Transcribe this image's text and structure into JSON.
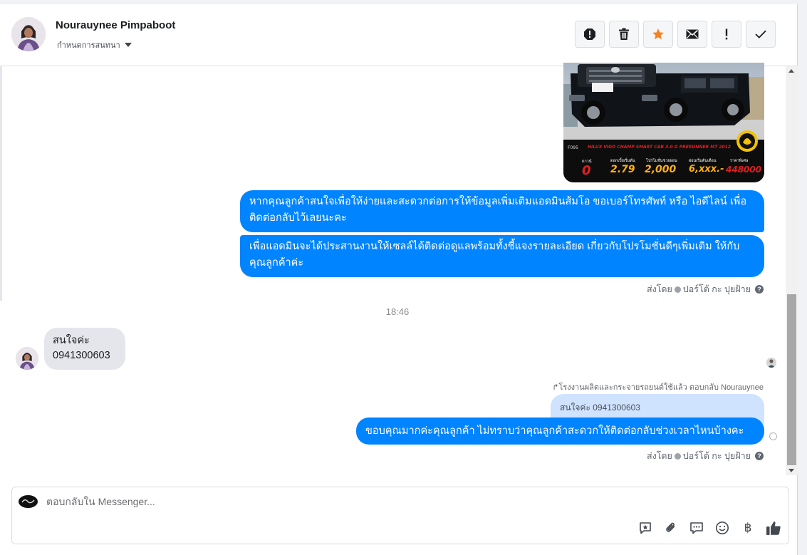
{
  "header": {
    "contact_name": "Nourauynee Pimpaboot",
    "assign_label": "กำหนดการสนทนา",
    "actions": [
      {
        "name": "report-icon",
        "label": "!"
      },
      {
        "name": "trash-icon",
        "label": ""
      },
      {
        "name": "star-icon",
        "label": ""
      },
      {
        "name": "envelope-icon",
        "label": ""
      },
      {
        "name": "exclamation-icon",
        "label": "!"
      },
      {
        "name": "checkmark-icon",
        "label": ""
      }
    ],
    "star_color": "#f5821f"
  },
  "car_ad": {
    "model_text": "HILUX VIGO CHAMP SMART CAB 3.0 G PRERUNNER MT 2012",
    "code": "F095",
    "down_label": "ดาวน์",
    "down_value": "0",
    "interest_label": "ดอกเบี้ยเริ่มต้น",
    "interest_value": "2.79",
    "promo_label": "โปรโมชั่นช่วยผ่อน",
    "promo_value": "2,000",
    "monthly_label": "ผ่อนเริ่มต้นเดือน",
    "monthly_value": "6,xxx.-",
    "price_label": "ราคาพิเศษ",
    "price_value": "448000"
  },
  "messages": {
    "out1": "หากคุณลูกค้าสนใจเพื่อให้ง่ายและสะดวกต่อการให้ข้อมูลเพิ่มเติมแอดมินส้มโอ ขอเบอร์โทรศัพท์ หรือ ไอดีไลน์ เพื่อติดต่อกลับไว้เลยนะคะ",
    "out2": "เพื่อแอดมินจะได้ประสานงานให้เซลล์ได้ติดต่อดูแลพร้อมทั้งชี้แจงรายละเอียด เกี่ยวกับโปรโมชั่นดีๆเพิ่มเติม ให้กับคุณลูกค้าค่ะ",
    "sent_by_prefix": "ส่งโดย",
    "sent_by_name": "ปอร์โต้ กะ ปุยฝ้าย",
    "timestamp": "18:46",
    "in1_line1": "สนใจค่ะ",
    "in1_line2": "0941300603",
    "reply_note": "โรงงานผลิตและกระจายรถยนต์ใช้แล้ว ตอบกลับ Nourauynee",
    "quoted_text": "สนใจค่ะ 0941300603",
    "out3": "ขอบคุณมากค่ะคุณลูกค้า ไม่ทราบว่าคุณลูกค้าสะดวกให้ติดต่อกลับช่วงเวลาไหนบ้างคะ"
  },
  "composer": {
    "placeholder": "ตอบกลับใน Messenger...",
    "tools": [
      "saved-reply-icon",
      "attachment-icon",
      "quick-reply-icon",
      "emoji-icon",
      "baht-icon",
      "thumbs-up-icon"
    ],
    "baht_symbol": "฿"
  },
  "colors": {
    "bubble_out": "#0084ff",
    "bubble_in": "#e4e6eb",
    "quoted_bg": "#cfe3ff"
  }
}
